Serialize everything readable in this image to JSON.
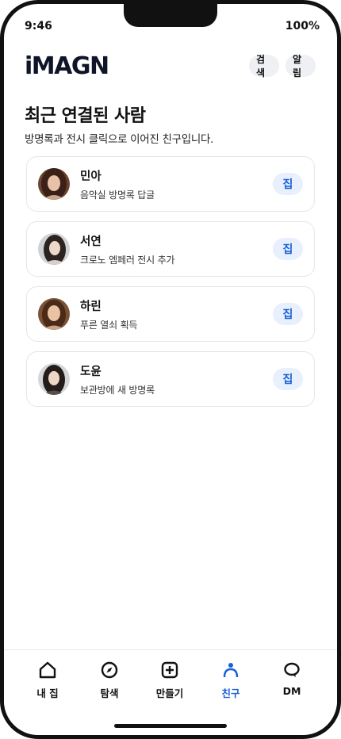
{
  "status": {
    "time": "9:46",
    "battery": "100%"
  },
  "header": {
    "logo": "iMAGN",
    "search_label": "검색",
    "alarm_label": "알림"
  },
  "section": {
    "title": "최근 연결된 사람",
    "subtitle": "방명록과 전시 클릭으로 이어진 친구입니다."
  },
  "friends": [
    {
      "name": "민아",
      "desc": "음악실 방명록 답글",
      "button": "집"
    },
    {
      "name": "서연",
      "desc": "크로노 엠페러 전시 추가",
      "button": "집"
    },
    {
      "name": "하린",
      "desc": "푸른 열쇠 획득",
      "button": "집"
    },
    {
      "name": "도윤",
      "desc": "보관방에 새 방명록",
      "button": "집"
    }
  ],
  "tabs": [
    {
      "label": "내 집",
      "icon": "home-icon"
    },
    {
      "label": "탐색",
      "icon": "compass-icon"
    },
    {
      "label": "만들기",
      "icon": "create-icon"
    },
    {
      "label": "친구",
      "icon": "person-icon",
      "active": true
    },
    {
      "label": "DM",
      "icon": "chat-icon"
    }
  ],
  "colors": {
    "accent": "#1a5fd6",
    "accent_bg": "#e8f0fd",
    "logo": "#0f1528"
  }
}
